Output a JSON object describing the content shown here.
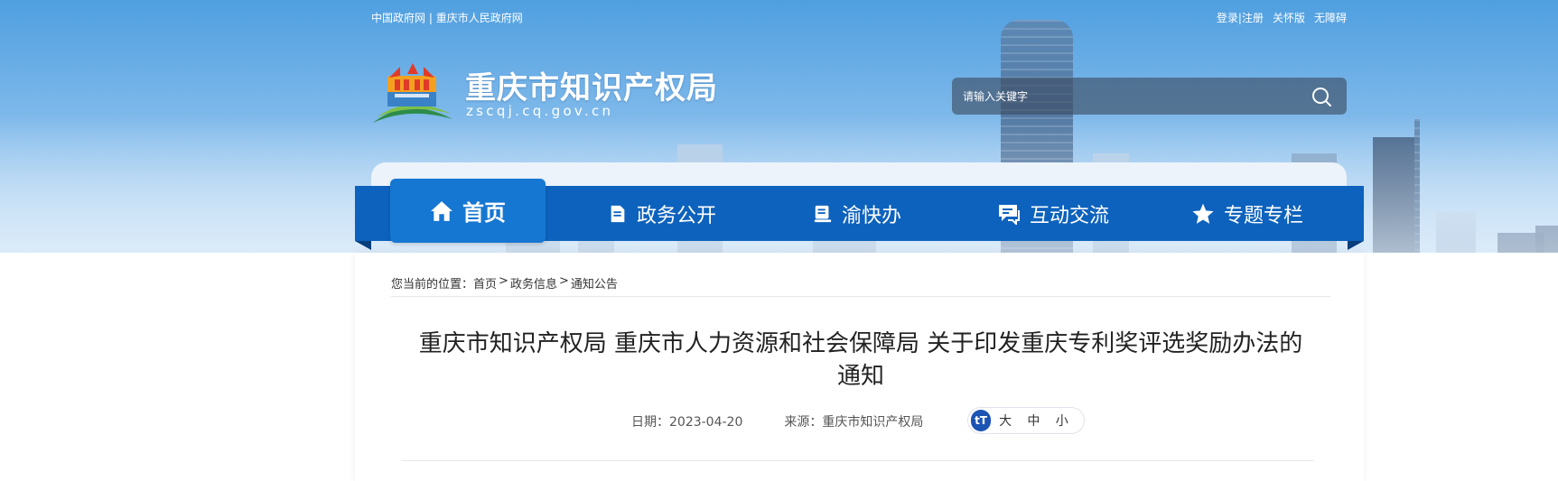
{
  "header": {
    "top_left_links": [
      "中国政府网",
      "重庆市人民政府网"
    ],
    "top_left_separator": "|",
    "top_right_links": [
      "登录|注册",
      "关怀版",
      "无障碍"
    ],
    "site_title": "重庆市知识产权局",
    "site_domain": "zscqj.cq.gov.cn",
    "search": {
      "placeholder": "请输入关键字",
      "icon": "search-icon"
    }
  },
  "nav": {
    "items": [
      {
        "label": "首页",
        "icon": "home-icon",
        "active": true
      },
      {
        "label": "政务公开",
        "icon": "document-icon",
        "active": false
      },
      {
        "label": "渝快办",
        "icon": "book-icon",
        "active": false
      },
      {
        "label": "互动交流",
        "icon": "chat-icon",
        "active": false
      },
      {
        "label": "专题专栏",
        "icon": "star-icon",
        "active": false
      }
    ]
  },
  "breadcrumb": {
    "prefix": "您当前的位置：",
    "items": [
      "首页",
      "政务信息",
      "通知公告"
    ],
    "separator": ">"
  },
  "article": {
    "title_line1": "重庆市知识产权局 重庆市人力资源和社会保障局 关于印发重庆专利奖评选奖励办法的",
    "title_line2": "通知",
    "date_label": "日期：",
    "date": "2023-04-20",
    "source_label": "来源：",
    "source": "重庆市知识产权局",
    "font_size": {
      "badge": "tT",
      "options": [
        "大",
        "中",
        "小"
      ]
    }
  },
  "colors": {
    "nav_background": "#0d62bd",
    "nav_active": "#1677d2",
    "font_badge": "#1b54b3"
  }
}
